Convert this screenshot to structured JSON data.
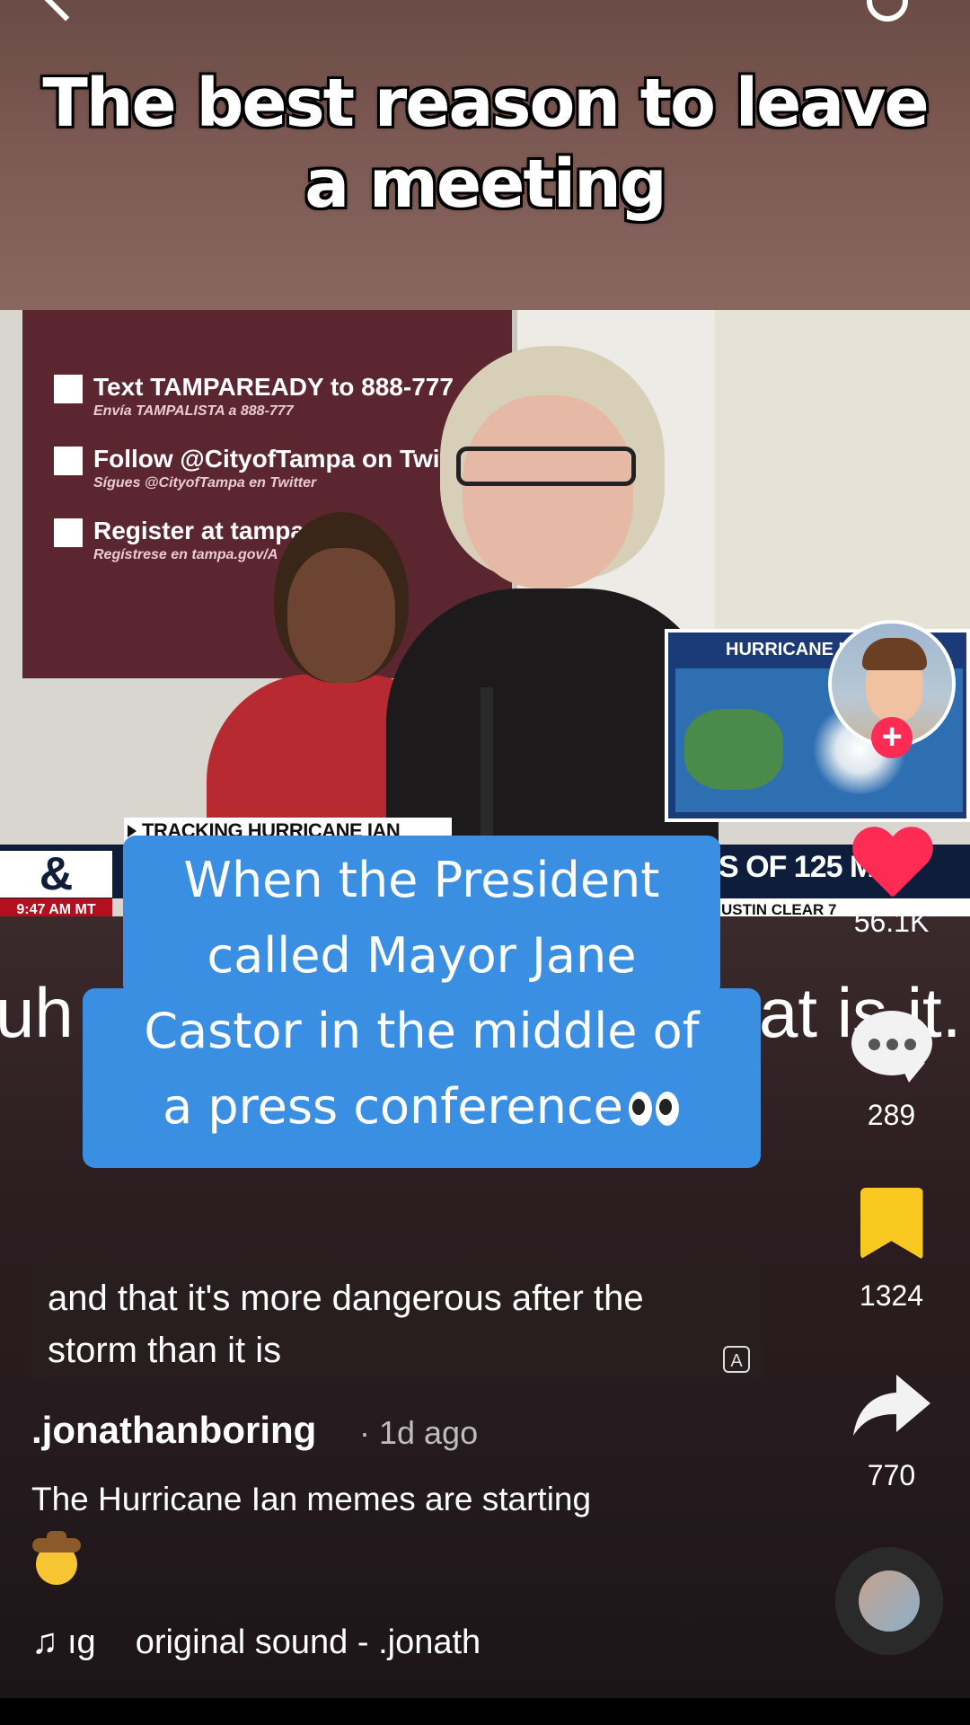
{
  "overlay_caption": "The best reason to leave a meeting",
  "video": {
    "banner_lines": [
      {
        "main": "Text TAMPAREADY to 888-777",
        "sub": "Envía TAMPALISTA a 888-777"
      },
      {
        "main": "Follow @CityofTampa on Twitt",
        "sub": "Sígues @CityofTampa en Twitter"
      },
      {
        "main": "Register at tampa.g",
        "sub": "Regístrese en tampa.gov/A"
      }
    ],
    "tag": "TRACKING HURRICANE IAN",
    "time": "9:47 AM MT",
    "speed": "S OF 125 MP",
    "weather": "USTIN  CLEAR  7",
    "pip_title": "HURRICANE I"
  },
  "behind_subtitle_left": "uh",
  "behind_subtitle_right": "at is it.",
  "blue_caption": {
    "line1": "When the President",
    "line2": "called Mayor Jane",
    "line3": "Castor in the middle of",
    "line4": "a press conference"
  },
  "rail": {
    "likes": "56.1K",
    "comments": "289",
    "saves": "1324",
    "shares": "770",
    "follow_label": "+"
  },
  "transcript": "and that it's more dangerous after the storm than it is",
  "username": ".jonathanboring",
  "meta": "· 1d ago",
  "description": "The Hurricane Ian memes are starting",
  "sound": {
    "prefix": "ıg",
    "name": "original sound - .jonath"
  },
  "icons": {
    "like": "heart-icon",
    "comment": "comment-icon",
    "save": "bookmark-icon",
    "share": "share-icon",
    "translate": "translate-icon",
    "music": "music-note-icon"
  },
  "colors": {
    "heart": "#fe2c55",
    "bookmark": "#f9c922",
    "caption_bg": "#3a8fe3"
  }
}
